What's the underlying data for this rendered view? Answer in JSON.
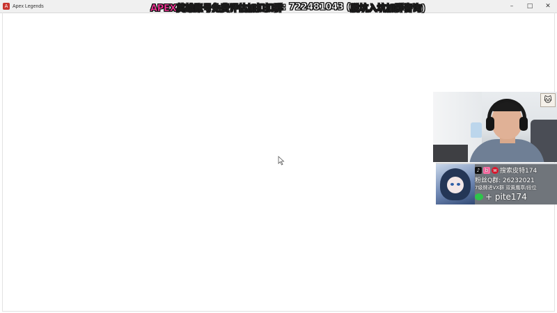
{
  "window": {
    "title": "Apex Legends",
    "controls": {
      "minimize": "–",
      "maximize": "□",
      "close": "✕"
    }
  },
  "banner": {
    "segments": [
      {
        "text": "APEX英雄账号",
        "color": "#ff2f9a"
      },
      {
        "text": "免费评估",
        "color": "#ffffff"
      },
      {
        "text": "加扣扣群",
        "color": "#ff2f9a"
      },
      {
        "text": ": 722481043 (",
        "color": "#ffffff"
      },
      {
        "text": "脱坑入坑",
        "color": "#ff2f9a"
      },
      {
        "text": "加群咨询)",
        "color": "#ffffff"
      }
    ]
  },
  "overlay": {
    "search_line": "搜索皮特174",
    "fan_group": "粉丝Q群: 26232021",
    "vx_line": "7级牌进VX群  双黄鹰章/段位",
    "wechat_id": "+ pite174"
  },
  "icons": {
    "tiktok": "tiktok-icon",
    "bilibili": "bilibili-icon",
    "weibo": "weibo-icon",
    "wechat": "wechat-icon",
    "cursor": "cursor-icon"
  }
}
